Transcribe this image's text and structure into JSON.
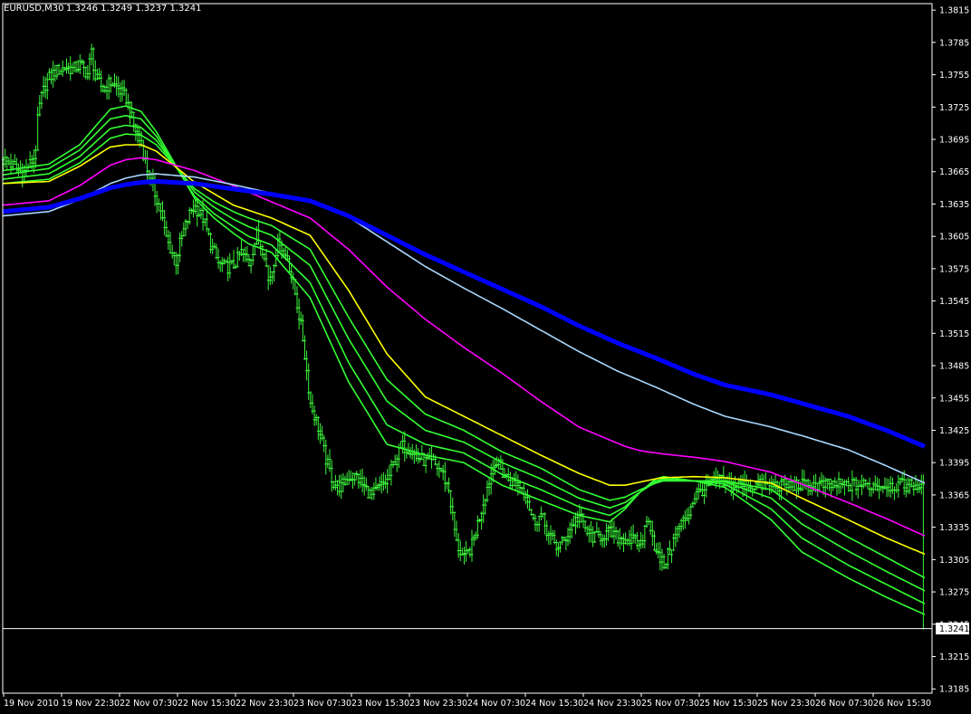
{
  "header": {
    "symbol_timeframe": "EURUSD,M30",
    "ohlc": "1.3246 1.3249 1.3237 1.3241"
  },
  "price_label": "1.3241",
  "colors": {
    "background": "#000000",
    "frame": "#ffffff",
    "candles": "#3cf53c",
    "ema_green": "#33ff33",
    "ema_yellow": "#ffff00",
    "ema_magenta": "#ff00ff",
    "ema_lightblue": "#a8d8ff",
    "ema_blue": "#0000ff",
    "price_line": "#ffffff"
  },
  "chart_data": {
    "type": "line",
    "title": "EURUSD,M30",
    "x_label": "",
    "y_label": "",
    "x_ticks": [
      "19 Nov 2010",
      "19 Nov 22:30",
      "22 Nov 07:30",
      "22 Nov 15:30",
      "22 Nov 23:30",
      "23 Nov 07:30",
      "23 Nov 15:30",
      "23 Nov 23:30",
      "24 Nov 07:30",
      "24 Nov 15:30",
      "24 Nov 23:30",
      "25 Nov 07:30",
      "25 Nov 15:30",
      "25 Nov 23:30",
      "26 Nov 07:30",
      "26 Nov 15:30"
    ],
    "y_ticks": [
      "1.3815",
      "1.3785",
      "1.3755",
      "1.3725",
      "1.3695",
      "1.3665",
      "1.3635",
      "1.3605",
      "1.3575",
      "1.3545",
      "1.3515",
      "1.3485",
      "1.3455",
      "1.3425",
      "1.3395",
      "1.3365",
      "1.3335",
      "1.3305",
      "1.3275",
      "1.3245",
      "1.3215",
      "1.3185"
    ],
    "ylim": [
      1.3181,
      1.3821
    ],
    "grid": false,
    "last_price": 1.3241,
    "price_series": {
      "name": "",
      "x": [
        0,
        4,
        8,
        10,
        12,
        14,
        16,
        17,
        18,
        19,
        20,
        22,
        24,
        27,
        30,
        33,
        36,
        40,
        44,
        46,
        48,
        52,
        56,
        60,
        64,
        68,
        72,
        76,
        80,
        82,
        84,
        86,
        88,
        90,
        92,
        94,
        96,
        98,
        100,
        104,
        108,
        112,
        116,
        120,
        124,
        128,
        132,
        136,
        138,
        140,
        142,
        144,
        146,
        148,
        150,
        152,
        154,
        156,
        158,
        160,
        164,
        168,
        172,
        176,
        180,
        184,
        188,
        192,
        196,
        200,
        204,
        208,
        212,
        216,
        220,
        224,
        228,
        232,
        236,
        240,
        244,
        248,
        252,
        256,
        260,
        264,
        268,
        272,
        276,
        280,
        284,
        288,
        292,
        296,
        300,
        304,
        308,
        312,
        316,
        320,
        324,
        328,
        332,
        336,
        340,
        344,
        348,
        352,
        356,
        360,
        364,
        368,
        372,
        376
      ],
      "values": [
        1.3676,
        1.3672,
        1.3666,
        1.3662,
        1.3668,
        1.3672,
        1.3678,
        1.3688,
        1.3712,
        1.3726,
        1.3734,
        1.3746,
        1.3752,
        1.3758,
        1.376,
        1.3762,
        1.376,
        1.3764,
        1.3756,
        1.3776,
        1.3752,
        1.3742,
        1.3748,
        1.3742,
        1.3733,
        1.3708,
        1.369,
        1.366,
        1.364,
        1.363,
        1.361,
        1.3598,
        1.359,
        1.3582,
        1.3598,
        1.361,
        1.362,
        1.363,
        1.3632,
        1.3622,
        1.3598,
        1.358,
        1.3576,
        1.3578,
        1.359,
        1.358,
        1.3606,
        1.359,
        1.3564,
        1.3574,
        1.3592,
        1.3602,
        1.3588,
        1.3586,
        1.3568,
        1.3552,
        1.3532,
        1.351,
        1.348,
        1.345,
        1.3428,
        1.3398,
        1.3376,
        1.3372,
        1.3382,
        1.3382,
        1.3372,
        1.3364,
        1.3372,
        1.3378,
        1.3398,
        1.341,
        1.3408,
        1.34,
        1.3396,
        1.3394,
        1.3388,
        1.337,
        1.332,
        1.3305,
        1.3318,
        1.3345,
        1.3372,
        1.3398,
        1.3385,
        1.3378,
        1.3376,
        1.3368,
        1.334,
        1.3346,
        1.3328,
        1.3317,
        1.3322,
        1.3337,
        1.3346,
        1.333,
        1.3325,
        1.3328,
        1.333,
        1.3325,
        1.3325,
        1.3322,
        1.332,
        1.3345,
        1.331,
        1.33,
        1.3318,
        1.3336,
        1.3345,
        1.3364,
        1.337,
        1.3374,
        1.338,
        1.3374
      ]
    },
    "series": [
      {
        "name": "",
        "color": "#33ff33",
        "x": [
          0,
          24,
          40,
          56,
          64,
          72,
          80,
          100,
          110,
          120,
          128,
          140,
          160,
          180,
          200,
          220,
          240,
          260,
          280,
          300,
          316,
          324,
          332,
          340,
          344,
          360,
          376,
          400,
          416,
          440,
          460,
          480
        ],
        "values": [
          1.3666,
          1.3672,
          1.369,
          1.3723,
          1.3726,
          1.3721,
          1.3702,
          1.364,
          1.3622,
          1.3608,
          1.3598,
          1.359,
          1.3548,
          1.347,
          1.3412,
          1.3402,
          1.3395,
          1.3374,
          1.336,
          1.3346,
          1.334,
          1.3352,
          1.3368,
          1.338,
          1.3382,
          1.3378,
          1.3372,
          1.3342,
          1.3312,
          1.3288,
          1.327,
          1.3254
        ]
      },
      {
        "name": "",
        "color": "#33ff33",
        "x": [
          0,
          24,
          40,
          56,
          64,
          72,
          80,
          100,
          110,
          120,
          128,
          140,
          160,
          180,
          200,
          220,
          240,
          260,
          280,
          300,
          316,
          324,
          332,
          340,
          344,
          360,
          376,
          400,
          416,
          440,
          460,
          480
        ],
        "values": [
          1.3662,
          1.3668,
          1.3685,
          1.3714,
          1.3717,
          1.3714,
          1.3698,
          1.3642,
          1.3626,
          1.3614,
          1.3605,
          1.3597,
          1.3562,
          1.3488,
          1.343,
          1.3412,
          1.3404,
          1.3384,
          1.337,
          1.3354,
          1.3346,
          1.3354,
          1.3368,
          1.3378,
          1.338,
          1.3378,
          1.3375,
          1.3352,
          1.3325,
          1.33,
          1.3282,
          1.3264
        ]
      },
      {
        "name": "",
        "color": "#33ff33",
        "x": [
          0,
          24,
          40,
          56,
          64,
          72,
          80,
          100,
          110,
          120,
          128,
          140,
          160,
          180,
          200,
          220,
          240,
          260,
          280,
          300,
          316,
          324,
          332,
          340,
          344,
          360,
          376,
          400,
          416,
          440,
          460,
          480
        ],
        "values": [
          1.3658,
          1.3663,
          1.3679,
          1.3705,
          1.3708,
          1.3706,
          1.3694,
          1.3646,
          1.3632,
          1.3621,
          1.3614,
          1.3606,
          1.3578,
          1.351,
          1.3452,
          1.3425,
          1.3414,
          1.3395,
          1.338,
          1.3362,
          1.3353,
          1.3358,
          1.3368,
          1.3377,
          1.3379,
          1.3378,
          1.3377,
          1.3362,
          1.3338,
          1.3313,
          1.3294,
          1.3276
        ]
      },
      {
        "name": "",
        "color": "#33ff33",
        "x": [
          0,
          24,
          40,
          56,
          64,
          72,
          80,
          100,
          110,
          120,
          128,
          140,
          160,
          180,
          200,
          220,
          240,
          260,
          280,
          300,
          316,
          324,
          332,
          340,
          344,
          360,
          376,
          400,
          416,
          440,
          460,
          480
        ],
        "values": [
          1.3654,
          1.3658,
          1.3673,
          1.3696,
          1.37,
          1.3699,
          1.369,
          1.3649,
          1.3637,
          1.3628,
          1.3622,
          1.3615,
          1.3593,
          1.353,
          1.3472,
          1.344,
          1.3425,
          1.3405,
          1.339,
          1.337,
          1.336,
          1.3363,
          1.337,
          1.3376,
          1.3378,
          1.3378,
          1.3378,
          1.337,
          1.335,
          1.3326,
          1.3307,
          1.3288
        ]
      },
      {
        "name": "",
        "color": "#ffff00",
        "x": [
          0,
          24,
          40,
          56,
          64,
          72,
          80,
          100,
          120,
          140,
          160,
          180,
          200,
          220,
          240,
          260,
          280,
          300,
          316,
          324,
          332,
          340,
          344,
          360,
          376,
          400,
          416,
          440,
          460,
          480
        ],
        "values": [
          1.3654,
          1.3656,
          1.367,
          1.3688,
          1.369,
          1.369,
          1.3684,
          1.3655,
          1.3634,
          1.3622,
          1.3606,
          1.3555,
          1.3496,
          1.3456,
          1.3438,
          1.342,
          1.3402,
          1.3385,
          1.3374,
          1.3374,
          1.3377,
          1.338,
          1.3381,
          1.3382,
          1.3381,
          1.3376,
          1.3362,
          1.3342,
          1.3325,
          1.331
        ]
      },
      {
        "name": "",
        "color": "#ff00ff",
        "x": [
          0,
          24,
          40,
          56,
          64,
          72,
          80,
          100,
          120,
          140,
          160,
          180,
          200,
          220,
          240,
          260,
          280,
          300,
          316,
          324,
          332,
          340,
          344,
          360,
          376,
          400,
          416,
          440,
          460,
          480
        ],
        "values": [
          1.3634,
          1.3638,
          1.3652,
          1.3671,
          1.3676,
          1.3678,
          1.3676,
          1.3666,
          1.3652,
          1.3637,
          1.3622,
          1.3593,
          1.3558,
          1.3528,
          1.3502,
          1.3478,
          1.3452,
          1.3428,
          1.3416,
          1.341,
          1.3406,
          1.3404,
          1.3403,
          1.34,
          1.3396,
          1.3386,
          1.3375,
          1.3358,
          1.3343,
          1.3327
        ]
      },
      {
        "name": "",
        "color": "#a8d8ff",
        "x": [
          0,
          24,
          40,
          56,
          64,
          72,
          80,
          100,
          120,
          140,
          160,
          180,
          200,
          220,
          240,
          260,
          280,
          300,
          320,
          340,
          360,
          376,
          400,
          416,
          440,
          460,
          480
        ],
        "values": [
          1.3624,
          1.3628,
          1.3639,
          1.3654,
          1.3659,
          1.3662,
          1.3663,
          1.366,
          1.3653,
          1.3645,
          1.3637,
          1.3623,
          1.36,
          1.3577,
          1.3557,
          1.3538,
          1.3518,
          1.3498,
          1.348,
          1.3465,
          1.3449,
          1.3438,
          1.3428,
          1.342,
          1.3407,
          1.3392,
          1.3376
        ]
      },
      {
        "name": "",
        "color": "#0000ff",
        "width": 5,
        "x": [
          0,
          24,
          40,
          56,
          64,
          72,
          80,
          100,
          120,
          140,
          160,
          180,
          200,
          220,
          240,
          260,
          280,
          300,
          320,
          340,
          360,
          376,
          400,
          416,
          440,
          460,
          480
        ],
        "values": [
          1.3628,
          1.3632,
          1.364,
          1.365,
          1.3653,
          1.3655,
          1.3656,
          1.3654,
          1.3649,
          1.3644,
          1.3638,
          1.3624,
          1.3606,
          1.3588,
          1.3572,
          1.3556,
          1.354,
          1.3522,
          1.3506,
          1.3492,
          1.3477,
          1.3467,
          1.3458,
          1.345,
          1.3438,
          1.3425,
          1.341
        ]
      }
    ]
  }
}
